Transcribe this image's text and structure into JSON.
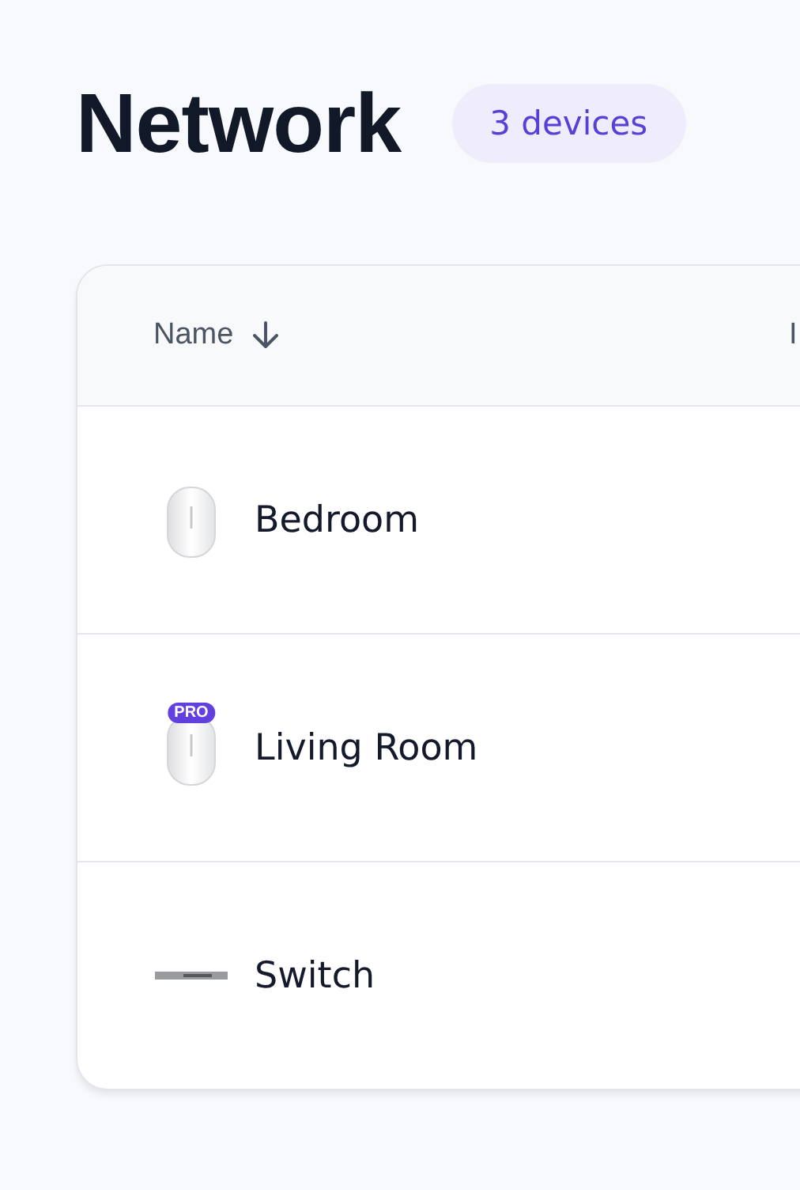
{
  "title": "Network",
  "badge": "3 devices",
  "table": {
    "columns": [
      {
        "label": "Name",
        "sorted": true
      },
      {
        "label": "I"
      }
    ],
    "rows": [
      {
        "kind": "ap",
        "pro": false,
        "name": "Bedroom"
      },
      {
        "kind": "ap",
        "pro": true,
        "pro_label": "PRO",
        "name": "Living Room"
      },
      {
        "kind": "switch",
        "pro": false,
        "name": "Switch"
      }
    ]
  }
}
